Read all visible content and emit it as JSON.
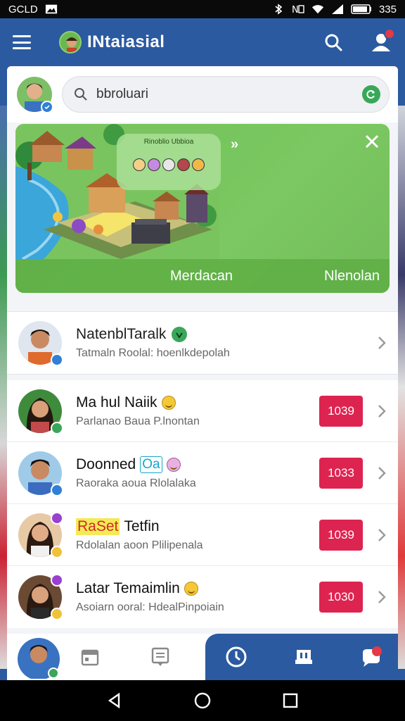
{
  "status_bar": {
    "carrier": "GCLD",
    "time": "335"
  },
  "app_bar": {
    "title": "INtaiasial"
  },
  "search": {
    "value": "bbroluari"
  },
  "banner": {
    "popup_title": "Rinoblio Ubbioa",
    "left_button": "Merdacan",
    "right_button": "Nlenolan"
  },
  "list": {
    "first": {
      "name": "NatenblTaralk",
      "subtitle": "Tatmaln Roolal: hoenlkdepolah"
    },
    "rows": [
      {
        "name": "Ma hul Naiik",
        "subtitle": "Parlanao Baua P.lnontan",
        "count": "1039",
        "badge_color": "#3aa65a"
      },
      {
        "name": "Doonned",
        "name_tag": "Oa",
        "subtitle": "Raoraka aoua Rlolalaka",
        "count": "1033",
        "badge_color": "#2f80d6"
      },
      {
        "name": "Tetfin",
        "name_tag": "RaSet",
        "subtitle": "Rdolalan aoon Plilipenala",
        "count": "1039",
        "badge_color": "#9a3fd0"
      },
      {
        "name": "Latar Temaimlin",
        "subtitle": "Asoiarn ooral: HdealPinpoiain",
        "count": "1030",
        "badge_color": "#9a3fd0"
      }
    ]
  },
  "colors": {
    "primary": "#2b5aa0",
    "accent_green": "#6bbf55",
    "count_red": "#dd2451"
  }
}
